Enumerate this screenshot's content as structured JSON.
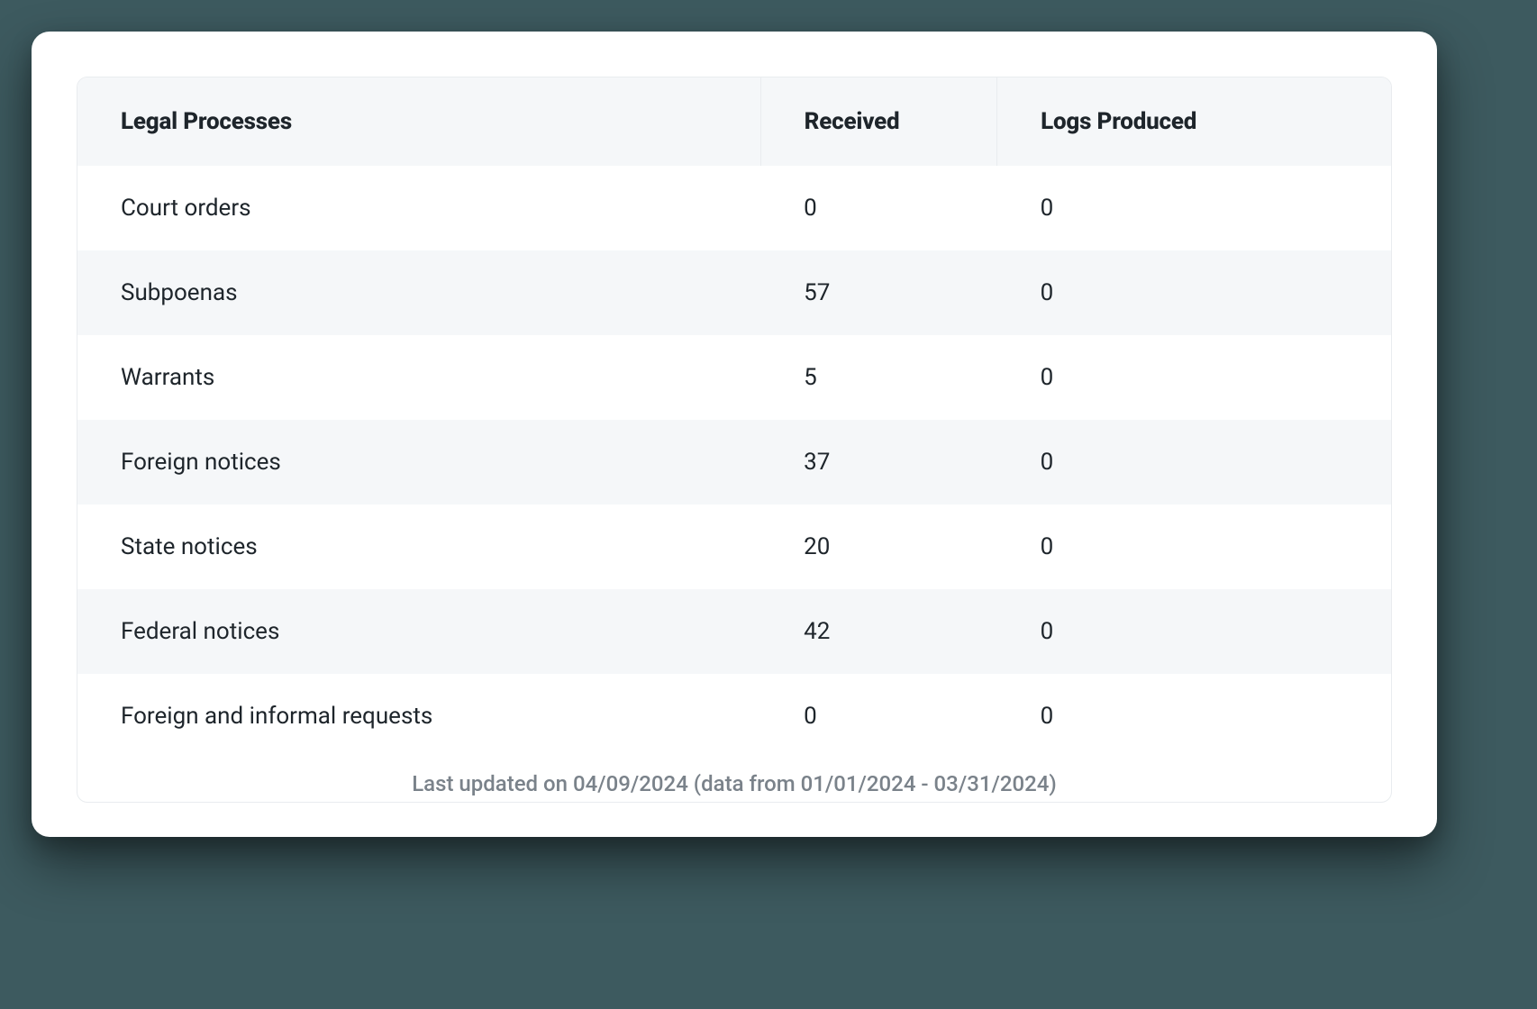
{
  "table": {
    "headers": {
      "legal": "Legal Processes",
      "received": "Received",
      "logs": "Logs Produced"
    },
    "rows": [
      {
        "legal": "Court orders",
        "received": "0",
        "logs": "0"
      },
      {
        "legal": "Subpoenas",
        "received": "57",
        "logs": "0"
      },
      {
        "legal": "Warrants",
        "received": "5",
        "logs": "0"
      },
      {
        "legal": "Foreign notices",
        "received": "37",
        "logs": "0"
      },
      {
        "legal": "State notices",
        "received": "20",
        "logs": "0"
      },
      {
        "legal": "Federal notices",
        "received": "42",
        "logs": "0"
      },
      {
        "legal": "Foreign and informal requests",
        "received": "0",
        "logs": "0"
      }
    ],
    "footer": "Last updated on 04/09/2024 (data from 01/01/2024 - 03/31/2024)"
  },
  "chart_data": {
    "type": "table",
    "columns": [
      "Legal Processes",
      "Received",
      "Logs Produced"
    ],
    "rows": [
      [
        "Court orders",
        0,
        0
      ],
      [
        "Subpoenas",
        57,
        0
      ],
      [
        "Warrants",
        5,
        0
      ],
      [
        "Foreign notices",
        37,
        0
      ],
      [
        "State notices",
        20,
        0
      ],
      [
        "Federal notices",
        42,
        0
      ],
      [
        "Foreign and informal requests",
        0,
        0
      ]
    ],
    "footer": "Last updated on 04/09/2024 (data from 01/01/2024 - 03/31/2024)"
  }
}
